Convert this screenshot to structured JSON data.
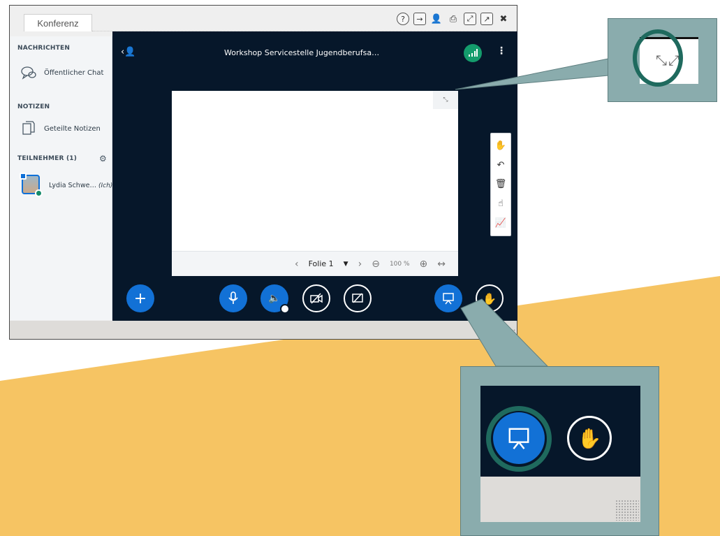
{
  "window": {
    "tab_label": "Konferenz"
  },
  "sidebar": {
    "messages_heading": "NACHRICHTEN",
    "public_chat_label": "Öffentlicher Chat",
    "notes_heading": "NOTIZEN",
    "shared_notes_label": "Geteilte Notizen",
    "participants_heading": "TEILNEHMER (1)",
    "user": {
      "name": "Lydia Schwe…",
      "self_marker": "(Ich)"
    }
  },
  "meeting": {
    "title": "Workshop Servicestelle Jugendberufsa…"
  },
  "presentation": {
    "slide_label": "Folie 1",
    "zoom_level": "100 %"
  },
  "colors": {
    "dark_bg": "#06172a",
    "accent_blue": "#1271d6",
    "signal_green": "#149c6c",
    "callout_bg": "#8aacad",
    "ring": "#1f6a5e",
    "yellow": "#f6c463"
  }
}
